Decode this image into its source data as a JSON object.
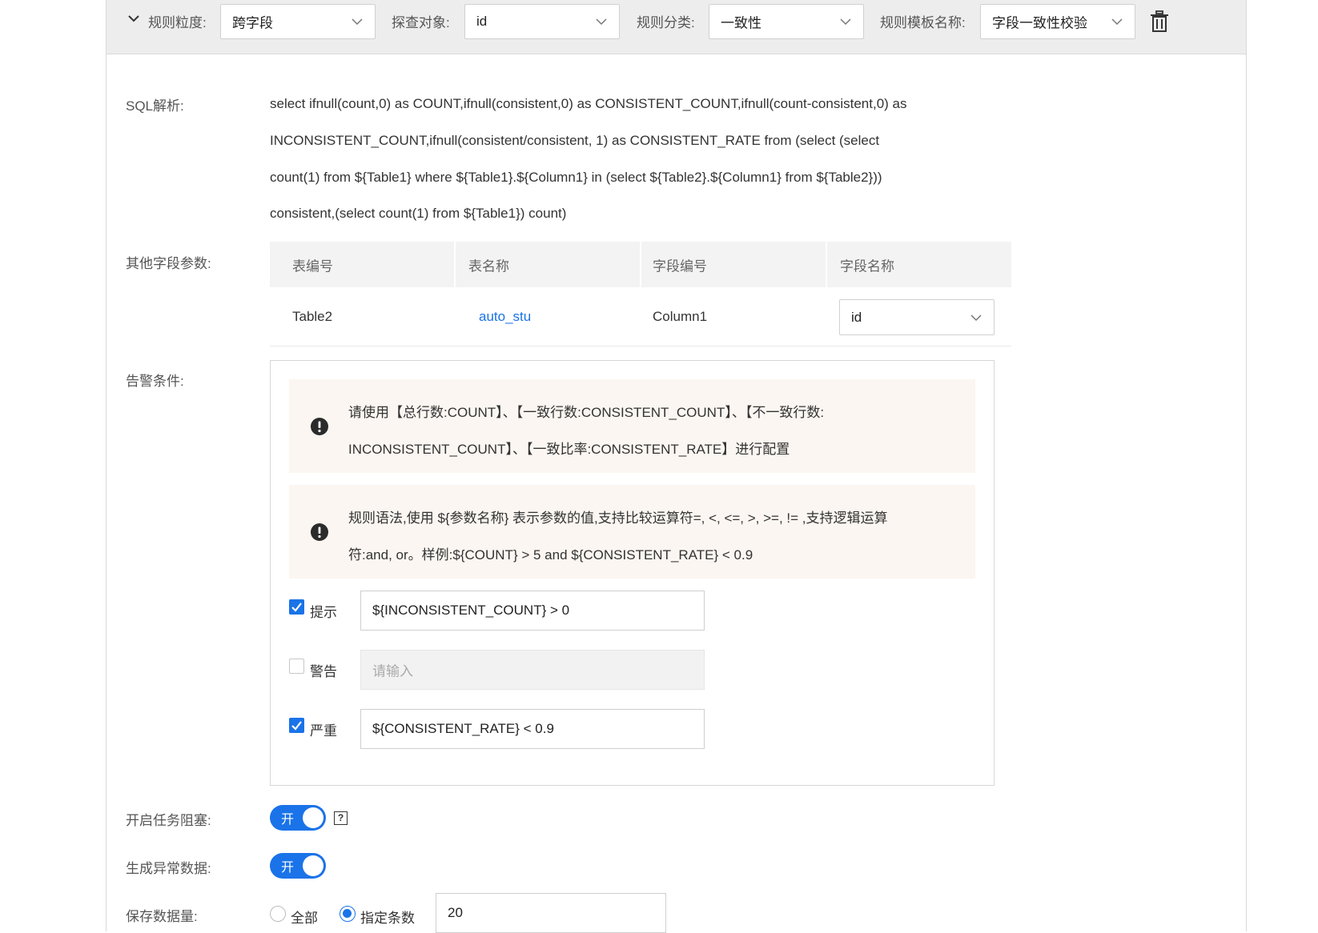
{
  "toolbar": {
    "granularity_label": "规则粒度:",
    "granularity_value": "跨字段",
    "target_label": "探查对象:",
    "target_value": "id",
    "category_label": "规则分类:",
    "category_value": "一致性",
    "template_label": "规则模板名称:",
    "template_value": "字段一致性校验"
  },
  "sql": {
    "label": "SQL解析:",
    "lines": [
      "select ifnull(count,0) as COUNT,ifnull(consistent,0) as CONSISTENT_COUNT,ifnull(count-consistent,0) as",
      "INCONSISTENT_COUNT,ifnull(consistent/consistent, 1) as CONSISTENT_RATE from (select (select",
      "count(1) from ${Table1} where ${Table1}.${Column1} in (select ${Table2}.${Column1} from ${Table2}))",
      "consistent,(select count(1) from ${Table1}) count)"
    ]
  },
  "other_params": {
    "label": "其他字段参数:",
    "headers": [
      "表编号",
      "表名称",
      "字段编号",
      "字段名称"
    ],
    "row": {
      "table_no": "Table2",
      "table_name": "auto_stu",
      "field_no": "Column1",
      "field_name": "id"
    }
  },
  "alarm": {
    "label": "告警条件:",
    "notice1": [
      "请使用【总行数:COUNT】、【一致行数:CONSISTENT_COUNT】、【不一致行数:",
      "INCONSISTENT_COUNT】、【一致比率:CONSISTENT_RATE】进行配置"
    ],
    "notice2": [
      "规则语法,使用 ${参数名称} 表示参数的值,支持比较运算符=, <, <=, >, >=, != ,支持逻辑运算",
      "符:and, or。样例:${COUNT} > 5 and ${CONSISTENT_RATE} < 0.9"
    ],
    "levels": [
      {
        "label": "提示",
        "checked": true,
        "value": "${INCONSISTENT_COUNT} > 0"
      },
      {
        "label": "警告",
        "checked": false,
        "placeholder": "请输入"
      },
      {
        "label": "严重",
        "checked": true,
        "value": "${CONSISTENT_RATE} < 0.9"
      }
    ]
  },
  "block_task": {
    "label": "开启任务阻塞:",
    "toggle_text": "开",
    "help": "?"
  },
  "gen_abnormal": {
    "label": "生成异常数据:",
    "toggle_text": "开"
  },
  "save_amount": {
    "label": "保存数据量:",
    "opt_all": "全部",
    "opt_specified": "指定条数",
    "count": "20"
  },
  "colors": {
    "accent": "#1a73e8",
    "link": "#1a73e8",
    "notice_bg": "#fbf6f1",
    "toolbar_bg": "#ededed"
  }
}
